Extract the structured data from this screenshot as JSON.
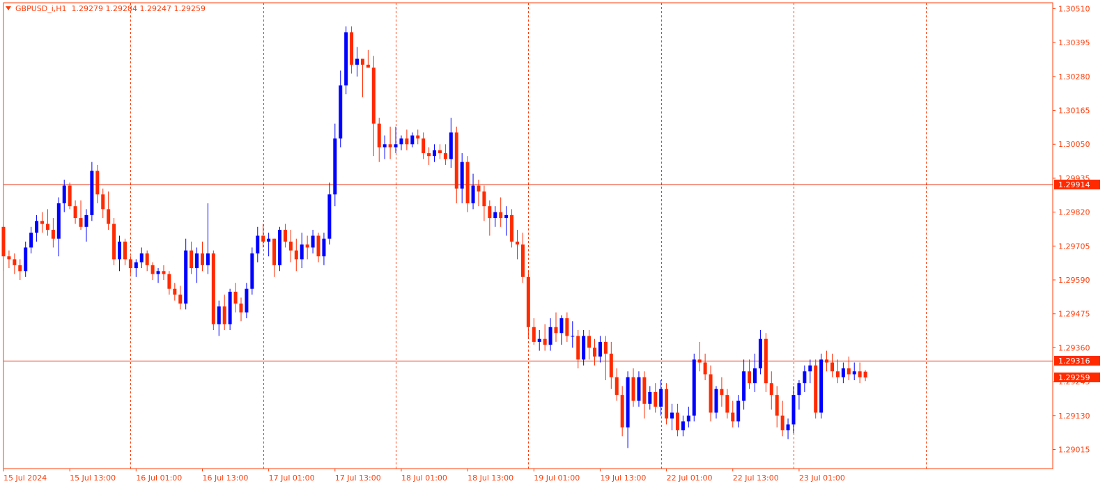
{
  "header": {
    "symbol": "GBPUSD_i,H1",
    "ohlc": "1.29279 1.29284 1.29247 1.29259"
  },
  "colors": {
    "axis": "#ff3d0a",
    "grid": "#ff3d0a",
    "bull": "#0000ff",
    "bear": "#ff2a00",
    "level_line": "#e81f00",
    "tag_bg": "#ff2a00",
    "tag_text": "#ffffff"
  },
  "chart_data": {
    "type": "candlestick",
    "timeframe": "H1",
    "ylim": [
      1.2895,
      1.3053
    ],
    "y_ticks": [
      "1.30510",
      "1.30395",
      "1.30280",
      "1.30165",
      "1.30050",
      "1.29935",
      "1.29820",
      "1.29705",
      "1.29590",
      "1.29475",
      "1.29360",
      "1.29245",
      "1.29130",
      "1.29015"
    ],
    "x_labels": [
      "15 Jul 2024",
      "15 Jul 13:00",
      "16 Jul 01:00",
      "16 Jul 13:00",
      "17 Jul 01:00",
      "17 Jul 13:00",
      "18 Jul 01:00",
      "18 Jul 13:00",
      "19 Jul 01:00",
      "19 Jul 13:00",
      "22 Jul 01:00",
      "22 Jul 13:00",
      "23 Jul 01:00"
    ],
    "x_label_bar_index": [
      0,
      12,
      24,
      36,
      48,
      60,
      72,
      84,
      96,
      108,
      120,
      132,
      144
    ],
    "vertical_grid_bar_index": [
      23,
      47,
      71,
      95,
      119,
      143,
      167
    ],
    "horizontal_levels": [
      {
        "price": 1.29914,
        "label": "1.29914"
      },
      {
        "price": 1.29316,
        "label": "1.29316"
      }
    ],
    "current_price": {
      "price": 1.29259,
      "label": "1.29259"
    },
    "candles": [
      [
        1.2977,
        1.2978,
        1.2962,
        1.2967
      ],
      [
        1.2967,
        1.2969,
        1.2963,
        1.2966
      ],
      [
        1.2966,
        1.2968,
        1.2961,
        1.2964
      ],
      [
        1.2964,
        1.2966,
        1.2959,
        1.2962
      ],
      [
        1.2962,
        1.2972,
        1.296,
        1.297
      ],
      [
        1.297,
        1.2977,
        1.2968,
        1.2975
      ],
      [
        1.2975,
        1.2981,
        1.2972,
        1.2979
      ],
      [
        1.2979,
        1.2982,
        1.2975,
        1.2978
      ],
      [
        1.2978,
        1.2983,
        1.2974,
        1.2976
      ],
      [
        1.2976,
        1.298,
        1.297,
        1.2973
      ],
      [
        1.2973,
        1.2987,
        1.2967,
        1.2985
      ],
      [
        1.2985,
        1.2993,
        1.2982,
        1.2991
      ],
      [
        1.2991,
        1.2992,
        1.2983,
        1.2984
      ],
      [
        1.2984,
        1.2986,
        1.2978,
        1.298
      ],
      [
        1.298,
        1.2986,
        1.2976,
        1.2977
      ],
      [
        1.2977,
        1.2983,
        1.2972,
        1.2981
      ],
      [
        1.2981,
        1.2999,
        1.2979,
        1.2996
      ],
      [
        1.2996,
        1.2998,
        1.2985,
        1.2988
      ],
      [
        1.2988,
        1.299,
        1.298,
        1.2983
      ],
      [
        1.2983,
        1.2989,
        1.2976,
        1.2978
      ],
      [
        1.2978,
        1.298,
        1.2964,
        1.2966
      ],
      [
        1.2966,
        1.2974,
        1.2962,
        1.2972
      ],
      [
        1.2972,
        1.2973,
        1.2964,
        1.2966
      ],
      [
        1.2966,
        1.2967,
        1.2961,
        1.2963
      ],
      [
        1.2963,
        1.2966,
        1.296,
        1.2965
      ],
      [
        1.2965,
        1.297,
        1.2963,
        1.2968
      ],
      [
        1.2968,
        1.2969,
        1.2962,
        1.2964
      ],
      [
        1.2964,
        1.2965,
        1.2959,
        1.2961
      ],
      [
        1.2961,
        1.2963,
        1.2958,
        1.2962
      ],
      [
        1.2962,
        1.2964,
        1.2959,
        1.2961
      ],
      [
        1.2961,
        1.2962,
        1.2954,
        1.2956
      ],
      [
        1.2956,
        1.2958,
        1.2952,
        1.2954
      ],
      [
        1.2954,
        1.2957,
        1.2949,
        1.2951
      ],
      [
        1.2951,
        1.2973,
        1.2949,
        1.2969
      ],
      [
        1.2969,
        1.2972,
        1.2961,
        1.2963
      ],
      [
        1.2963,
        1.297,
        1.2958,
        1.2968
      ],
      [
        1.2968,
        1.2972,
        1.2962,
        1.2964
      ],
      [
        1.2964,
        1.2985,
        1.2961,
        1.2968
      ],
      [
        1.2968,
        1.2969,
        1.2942,
        1.2944
      ],
      [
        1.2944,
        1.2952,
        1.294,
        1.295
      ],
      [
        1.295,
        1.2954,
        1.2942,
        1.2944
      ],
      [
        1.2944,
        1.2956,
        1.2942,
        1.2955
      ],
      [
        1.2955,
        1.2958,
        1.2948,
        1.2951
      ],
      [
        1.2951,
        1.2953,
        1.2945,
        1.2948
      ],
      [
        1.2948,
        1.2958,
        1.2946,
        1.2956
      ],
      [
        1.2956,
        1.297,
        1.2954,
        1.2968
      ],
      [
        1.2968,
        1.2977,
        1.2965,
        1.2974
      ],
      [
        1.2974,
        1.2978,
        1.297,
        1.2972
      ],
      [
        1.2972,
        1.2975,
        1.2967,
        1.2973
      ],
      [
        1.2973,
        1.2973,
        1.296,
        1.2964
      ],
      [
        1.2964,
        1.2977,
        1.2962,
        1.2976
      ],
      [
        1.2976,
        1.2978,
        1.297,
        1.2972
      ],
      [
        1.2972,
        1.2976,
        1.2965,
        1.2969
      ],
      [
        1.2969,
        1.2973,
        1.2962,
        1.2966
      ],
      [
        1.2966,
        1.2975,
        1.2963,
        1.2971
      ],
      [
        1.2971,
        1.2974,
        1.2966,
        1.297
      ],
      [
        1.297,
        1.2976,
        1.2968,
        1.2974
      ],
      [
        1.2974,
        1.2975,
        1.2965,
        1.2967
      ],
      [
        1.2967,
        1.2975,
        1.2964,
        1.2973
      ],
      [
        1.2973,
        1.2992,
        1.2971,
        1.2988
      ],
      [
        1.2988,
        1.3012,
        1.2984,
        1.3007
      ],
      [
        1.3007,
        1.303,
        1.3004,
        1.3025
      ],
      [
        1.3025,
        1.3045,
        1.3022,
        1.3043
      ],
      [
        1.3043,
        1.3045,
        1.3029,
        1.3032
      ],
      [
        1.3032,
        1.3038,
        1.3028,
        1.3034
      ],
      [
        1.3034,
        1.3034,
        1.3021,
        1.3032
      ],
      [
        1.3032,
        1.3037,
        1.3031,
        1.3031
      ],
      [
        1.3031,
        1.3035,
        1.3001,
        1.3012
      ],
      [
        1.3012,
        1.3014,
        1.2999,
        1.3004
      ],
      [
        1.3004,
        1.3008,
        1.3,
        1.3005
      ],
      [
        1.3005,
        1.3011,
        1.3,
        1.3004
      ],
      [
        1.3004,
        1.3011,
        1.3002,
        1.3005
      ],
      [
        1.3005,
        1.3008,
        1.3003,
        1.3007
      ],
      [
        1.3007,
        1.301,
        1.3003,
        1.3005
      ],
      [
        1.3005,
        1.3009,
        1.3004,
        1.3008
      ],
      [
        1.3008,
        1.301,
        1.3005,
        1.3007
      ],
      [
        1.3007,
        1.3009,
        1.3,
        1.3002
      ],
      [
        1.3002,
        1.3004,
        1.2998,
        1.3001
      ],
      [
        1.3001,
        1.3005,
        1.2999,
        1.3003
      ],
      [
        1.3003,
        1.3005,
        1.3,
        1.3002
      ],
      [
        1.3002,
        1.3005,
        1.2998,
        1.3
      ],
      [
        1.3,
        1.3014,
        1.2997,
        1.3009
      ],
      [
        1.3009,
        1.3011,
        1.2985,
        1.299
      ],
      [
        1.299,
        1.3002,
        1.2985,
        1.2999
      ],
      [
        1.2999,
        1.3001,
        1.2982,
        1.2985
      ],
      [
        1.2985,
        1.2995,
        1.2983,
        1.2991
      ],
      [
        1.2991,
        1.2993,
        1.2984,
        1.2989
      ],
      [
        1.2989,
        1.2991,
        1.2979,
        1.2984
      ],
      [
        1.2984,
        1.2986,
        1.2974,
        1.298
      ],
      [
        1.298,
        1.2984,
        1.2977,
        1.2982
      ],
      [
        1.2982,
        1.2987,
        1.2977,
        1.298
      ],
      [
        1.298,
        1.2984,
        1.2974,
        1.2981
      ],
      [
        1.2981,
        1.2983,
        1.297,
        1.2972
      ],
      [
        1.2972,
        1.2976,
        1.2966,
        1.2971
      ],
      [
        1.2971,
        1.2975,
        1.2958,
        1.296
      ],
      [
        1.296,
        1.2962,
        1.2939,
        1.2943
      ],
      [
        1.2943,
        1.2946,
        1.2937,
        1.2938
      ],
      [
        1.2938,
        1.2942,
        1.2935,
        1.2939
      ],
      [
        1.2939,
        1.2944,
        1.2935,
        1.2937
      ],
      [
        1.2937,
        1.2946,
        1.2935,
        1.2943
      ],
      [
        1.2943,
        1.2948,
        1.2938,
        1.2941
      ],
      [
        1.2941,
        1.2947,
        1.2937,
        1.2946
      ],
      [
        1.2946,
        1.2948,
        1.2938,
        1.294
      ],
      [
        1.294,
        1.2945,
        1.2936,
        1.294
      ],
      [
        1.294,
        1.2942,
        1.2929,
        1.2932
      ],
      [
        1.2932,
        1.2942,
        1.293,
        1.294
      ],
      [
        1.294,
        1.2942,
        1.2932,
        1.2936
      ],
      [
        1.2936,
        1.2939,
        1.293,
        1.2933
      ],
      [
        1.2933,
        1.294,
        1.2931,
        1.2938
      ],
      [
        1.2938,
        1.294,
        1.2925,
        1.2934
      ],
      [
        1.2934,
        1.2938,
        1.2922,
        1.2926
      ],
      [
        1.2926,
        1.2929,
        1.2918,
        1.292
      ],
      [
        1.292,
        1.2923,
        1.2906,
        1.2909
      ],
      [
        1.2909,
        1.2928,
        1.2902,
        1.2926
      ],
      [
        1.2926,
        1.2929,
        1.2916,
        1.2918
      ],
      [
        1.2918,
        1.2928,
        1.2916,
        1.2926
      ],
      [
        1.2926,
        1.2928,
        1.2912,
        1.2917
      ],
      [
        1.2917,
        1.2923,
        1.2915,
        1.2921
      ],
      [
        1.2921,
        1.2924,
        1.2914,
        1.2916
      ],
      [
        1.2916,
        1.2925,
        1.2913,
        1.2922
      ],
      [
        1.2922,
        1.2924,
        1.291,
        1.2912
      ],
      [
        1.2912,
        1.2917,
        1.2908,
        1.2914
      ],
      [
        1.2914,
        1.2917,
        1.2906,
        1.2908
      ],
      [
        1.2908,
        1.2913,
        1.2906,
        1.2911
      ],
      [
        1.2911,
        1.2916,
        1.2909,
        1.2913
      ],
      [
        1.2913,
        1.2934,
        1.2911,
        1.2932
      ],
      [
        1.2932,
        1.2938,
        1.2928,
        1.2931
      ],
      [
        1.2931,
        1.2934,
        1.2925,
        1.2927
      ],
      [
        1.2927,
        1.293,
        1.2911,
        1.2914
      ],
      [
        1.2914,
        1.2923,
        1.2912,
        1.2922
      ],
      [
        1.2922,
        1.2926,
        1.2916,
        1.292
      ],
      [
        1.292,
        1.2922,
        1.2912,
        1.2914
      ],
      [
        1.2914,
        1.2918,
        1.2909,
        1.2911
      ],
      [
        1.2911,
        1.292,
        1.2909,
        1.2918
      ],
      [
        1.2918,
        1.2932,
        1.2915,
        1.2928
      ],
      [
        1.2928,
        1.2932,
        1.2922,
        1.2924
      ],
      [
        1.2924,
        1.2934,
        1.2921,
        1.2929
      ],
      [
        1.2929,
        1.2942,
        1.2927,
        1.2939
      ],
      [
        1.2939,
        1.2941,
        1.2921,
        1.2924
      ],
      [
        1.2924,
        1.2928,
        1.2915,
        1.292
      ],
      [
        1.292,
        1.2923,
        1.2909,
        1.2913
      ],
      [
        1.2913,
        1.2918,
        1.2906,
        1.2908
      ],
      [
        1.2908,
        1.2912,
        1.2905,
        1.291
      ],
      [
        1.291,
        1.2923,
        1.2907,
        1.292
      ],
      [
        1.292,
        1.2925,
        1.2915,
        1.2924
      ],
      [
        1.2924,
        1.293,
        1.2921,
        1.2928
      ],
      [
        1.2928,
        1.2932,
        1.2924,
        1.293
      ],
      [
        1.293,
        1.2932,
        1.2912,
        1.2914
      ],
      [
        1.2914,
        1.2934,
        1.2912,
        1.2932
      ],
      [
        1.2932,
        1.2935,
        1.2928,
        1.2931
      ],
      [
        1.2931,
        1.2934,
        1.2926,
        1.2928
      ],
      [
        1.2928,
        1.2932,
        1.2924,
        1.2926
      ],
      [
        1.2926,
        1.2931,
        1.2924,
        1.2929
      ],
      [
        1.2929,
        1.2933,
        1.2925,
        1.2927
      ],
      [
        1.2927,
        1.2931,
        1.2925,
        1.2928
      ],
      [
        1.2928,
        1.2931,
        1.2924,
        1.2926
      ],
      [
        1.29279,
        1.29284,
        1.29247,
        1.29259
      ]
    ]
  }
}
